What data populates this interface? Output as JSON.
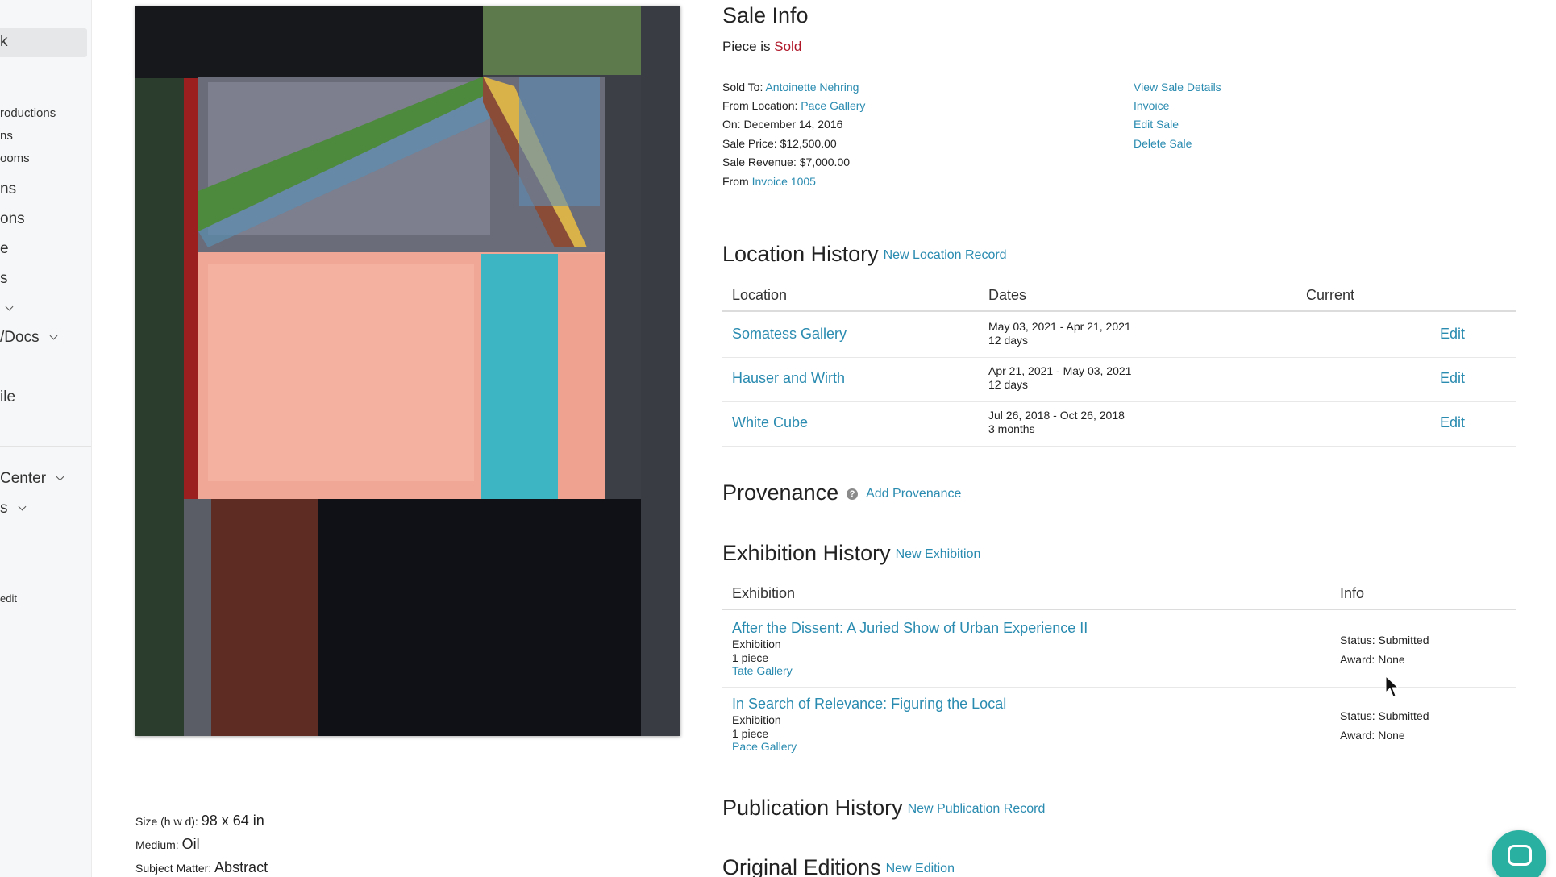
{
  "sidebar": {
    "items": [
      {
        "label": "k"
      },
      {
        "label": "roductions"
      },
      {
        "label": "ns"
      },
      {
        "label": "ooms"
      },
      {
        "label": "ns"
      },
      {
        "label": "ons"
      },
      {
        "label": "e"
      },
      {
        "label": "s"
      },
      {
        "label": "/Docs"
      },
      {
        "label": "ile"
      },
      {
        "label": "Center"
      },
      {
        "label": "s"
      },
      {
        "label": "edit"
      }
    ]
  },
  "artwork": {
    "size_label": "Size (h w d):",
    "size_value": "98 x 64 in",
    "medium_label": "Medium:",
    "medium_value": "Oil",
    "subject_label": "Subject Matter:",
    "subject_value": "Abstract"
  },
  "sale_info": {
    "title": "Sale Info",
    "piece_is": "Piece is",
    "status": "Sold",
    "sold_to_label": "Sold To:",
    "sold_to": "Antoinette Nehring",
    "from_location_label": "From Location:",
    "from_location": "Pace Gallery",
    "on": "On: December 14, 2016",
    "sale_price": "Sale Price: $12,500.00",
    "sale_revenue": "Sale Revenue: $7,000.00",
    "from_label": "From",
    "from_invoice": "Invoice 1005",
    "actions": [
      "View Sale Details",
      "Invoice",
      "Edit Sale",
      "Delete Sale"
    ]
  },
  "location_history": {
    "title": "Location History",
    "new_link": "New Location Record",
    "columns": [
      "Location",
      "Dates",
      "Current"
    ],
    "edit_label": "Edit",
    "rows": [
      {
        "location": "Somatess Gallery",
        "dates": "May 03, 2021 - Apr 21, 2021",
        "duration": "12 days"
      },
      {
        "location": "Hauser and Wirth",
        "dates": "Apr 21, 2021 - May 03, 2021",
        "duration": "12 days"
      },
      {
        "location": "White Cube",
        "dates": "Jul 26, 2018 - Oct 26, 2018",
        "duration": "3 months"
      }
    ]
  },
  "provenance": {
    "title": "Provenance",
    "help": "?",
    "add_link": "Add Provenance"
  },
  "exhibition_history": {
    "title": "Exhibition History",
    "new_link": "New Exhibition",
    "columns": [
      "Exhibition",
      "Info"
    ],
    "rows": [
      {
        "title": "After the Dissent: A Juried Show of Urban Experience II",
        "type": "Exhibition",
        "pieces": "1 piece",
        "venue": "Tate Gallery",
        "status": "Status: Submitted",
        "award": "Award: None"
      },
      {
        "title": "In Search of Relevance: Figuring the Local",
        "type": "Exhibition",
        "pieces": "1 piece",
        "venue": "Pace Gallery",
        "status": "Status: Submitted",
        "award": "Award: None"
      }
    ]
  },
  "publication_history": {
    "title": "Publication History",
    "new_link": "New Publication Record"
  },
  "original_editions": {
    "title": "Original Editions",
    "new_link": "New Edition"
  }
}
